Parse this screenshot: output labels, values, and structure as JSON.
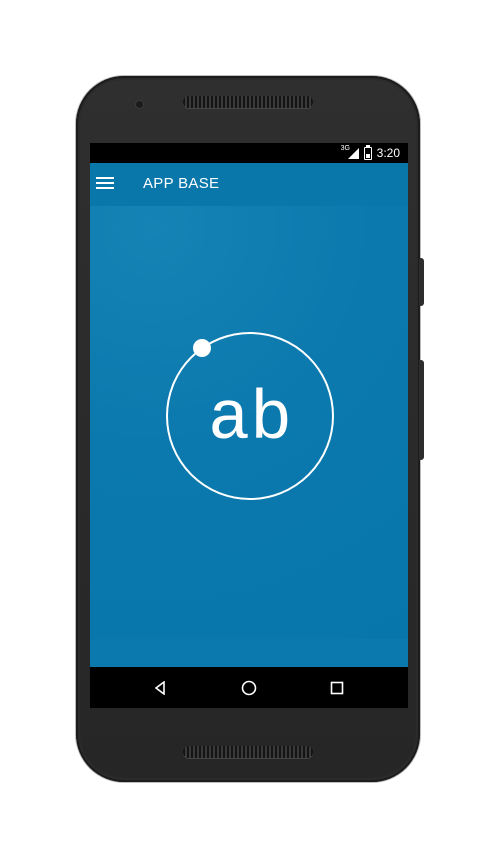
{
  "status_bar": {
    "network": "3G",
    "time": "3:20"
  },
  "app_bar": {
    "title": "APP BASE"
  },
  "logo": {
    "text": "ab"
  },
  "icons": {
    "menu": "hamburger-menu-icon",
    "back": "back-icon",
    "home": "home-icon",
    "recents": "recents-icon"
  },
  "colors": {
    "primary": "#0b79ad",
    "status_bar": "#000000",
    "nav_bar": "#000000",
    "logo_stroke": "#ffffff"
  }
}
